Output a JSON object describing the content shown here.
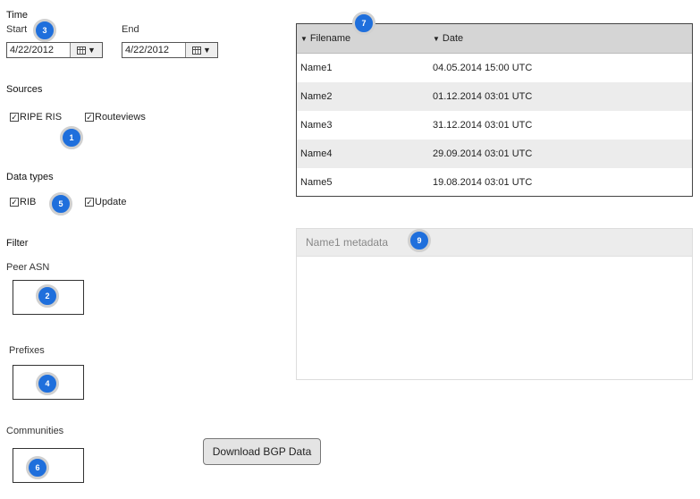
{
  "time": {
    "title": "Time",
    "start_label": "Start",
    "end_label": "End",
    "start_value": "4/22/2012",
    "end_value": "4/22/2012"
  },
  "sources": {
    "title": "Sources",
    "items": [
      {
        "label": "RIPE RIS",
        "checked": true
      },
      {
        "label": "Routeviews",
        "checked": true
      }
    ]
  },
  "data_types": {
    "title": "Data types",
    "items": [
      {
        "label": "RIB",
        "checked": true
      },
      {
        "label": "Update",
        "checked": true
      }
    ]
  },
  "filter": {
    "title": "Filter",
    "peer_asn_label": "Peer ASN",
    "prefixes_label": "Prefixes",
    "communities_label": "Communities"
  },
  "download_button": "Download BGP Data",
  "badges": [
    "1",
    "2",
    "3",
    "4",
    "5",
    "6",
    "7",
    "9"
  ],
  "table": {
    "columns": [
      "Filename",
      "Date"
    ],
    "rows": [
      {
        "filename": "Name1",
        "date": "04.05.2014 15:00 UTC"
      },
      {
        "filename": "Name2",
        "date": "01.12.2014 03:01 UTC"
      },
      {
        "filename": "Name3",
        "date": "31.12.2014 03:01 UTC"
      },
      {
        "filename": "Name4",
        "date": "29.09.2014 03:01 UTC"
      },
      {
        "filename": "Name5",
        "date": "19.08.2014 03:01 UTC"
      }
    ]
  },
  "metadata": {
    "title": "Name1 metadata"
  },
  "colors": {
    "badge": "#1f6fdc",
    "table_header": "#d5d5d5",
    "alt_row": "#ececec"
  },
  "icons": {
    "date_picker": "calendar-icon",
    "dropdown": "triangle-down-icon",
    "checkbox": "checkmark-icon",
    "sort": "sort-triangle-icon"
  }
}
